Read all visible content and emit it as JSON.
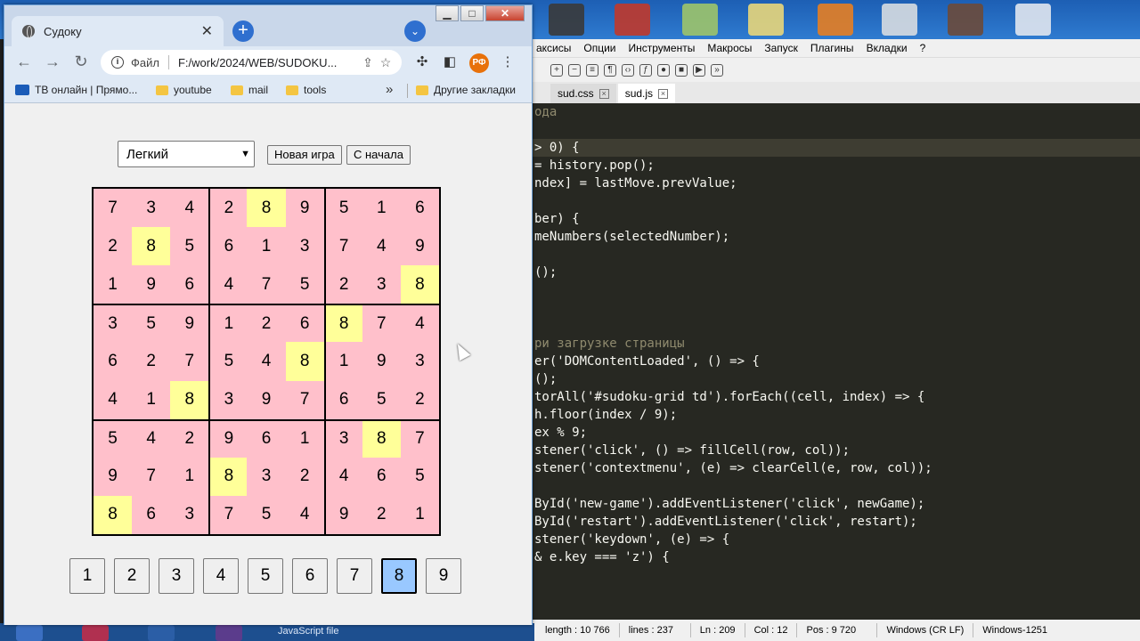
{
  "browser": {
    "tab_title": "Судоку",
    "url_scheme": "Файл",
    "url": "F:/work/2024/WEB/SUDOKU...",
    "avatar_initials": "РФ",
    "bookmarks": [
      {
        "label": "ТВ онлайн | Прямо...",
        "icon": "tv-icon"
      },
      {
        "label": "youtube",
        "icon": "folder-icon"
      },
      {
        "label": "mail",
        "icon": "folder-icon"
      },
      {
        "label": "tools",
        "icon": "folder-icon"
      }
    ],
    "other_bookmarks": "Другие закладки"
  },
  "game": {
    "difficulty_selected": "Легкий",
    "new_game_label": "Новая игра",
    "restart_label": "С начала",
    "selected_number": 8,
    "highlight_color": "#ffff99",
    "cell_color": "#ffc0cb",
    "grid": [
      [
        7,
        3,
        4,
        2,
        8,
        9,
        5,
        1,
        6
      ],
      [
        2,
        8,
        5,
        6,
        1,
        3,
        7,
        4,
        9
      ],
      [
        1,
        9,
        6,
        4,
        7,
        5,
        2,
        3,
        8
      ],
      [
        3,
        5,
        9,
        1,
        2,
        6,
        8,
        7,
        4
      ],
      [
        6,
        2,
        7,
        5,
        4,
        8,
        1,
        9,
        3
      ],
      [
        4,
        1,
        8,
        3,
        9,
        7,
        6,
        5,
        2
      ],
      [
        5,
        4,
        2,
        9,
        6,
        1,
        3,
        8,
        7
      ],
      [
        9,
        7,
        1,
        8,
        3,
        2,
        4,
        6,
        5
      ],
      [
        8,
        6,
        3,
        7,
        5,
        4,
        9,
        2,
        1
      ]
    ],
    "number_pad": [
      "1",
      "2",
      "3",
      "4",
      "5",
      "6",
      "7",
      "8",
      "9"
    ]
  },
  "editor": {
    "menu": [
      "аксисы",
      "Опции",
      "Инструменты",
      "Макросы",
      "Запуск",
      "Плагины",
      "Вкладки",
      "?"
    ],
    "tabs": [
      {
        "label": "sud.css",
        "active": false
      },
      {
        "label": "sud.js",
        "active": true
      }
    ],
    "code_lines": [
      {
        "text": "ода",
        "type": "comment"
      },
      {
        "text": "",
        "type": ""
      },
      {
        "text": "> 0) {",
        "type": "hl"
      },
      {
        "text": "= history.pop();",
        "type": ""
      },
      {
        "text": "ndex] = lastMove.prevValue;",
        "type": ""
      },
      {
        "text": "",
        "type": ""
      },
      {
        "text": "ber) {",
        "type": ""
      },
      {
        "text": "meNumbers(selectedNumber);",
        "type": ""
      },
      {
        "text": "",
        "type": ""
      },
      {
        "text": "();",
        "type": ""
      },
      {
        "text": "",
        "type": ""
      },
      {
        "text": "",
        "type": ""
      },
      {
        "text": "",
        "type": ""
      },
      {
        "text": "ри загрузке страницы",
        "type": "comment"
      },
      {
        "text": "er('DOMContentLoaded', () => {",
        "type": ""
      },
      {
        "text": "();",
        "type": ""
      },
      {
        "text": "torAll('#sudoku-grid td').forEach((cell, index) => {",
        "type": ""
      },
      {
        "text": "h.floor(index / 9);",
        "type": ""
      },
      {
        "text": "ex % 9;",
        "type": ""
      },
      {
        "text": "stener('click', () => fillCell(row, col));",
        "type": ""
      },
      {
        "text": "stener('contextmenu', (e) => clearCell(e, row, col));",
        "type": ""
      },
      {
        "text": "",
        "type": ""
      },
      {
        "text": "ById('new-game').addEventListener('click', newGame);",
        "type": ""
      },
      {
        "text": "ById('restart').addEventListener('click', restart);",
        "type": ""
      },
      {
        "text": "stener('keydown', (e) => {",
        "type": ""
      },
      {
        "text": "& e.key === 'z') {",
        "type": ""
      }
    ],
    "status": [
      "length : 10 766",
      "lines : 237",
      "Ln : 209",
      "Col : 12",
      "Pos : 9 720",
      "Windows (CR LF)",
      "Windows-1251"
    ]
  },
  "taskbar": {
    "label": "JavaScript file"
  }
}
